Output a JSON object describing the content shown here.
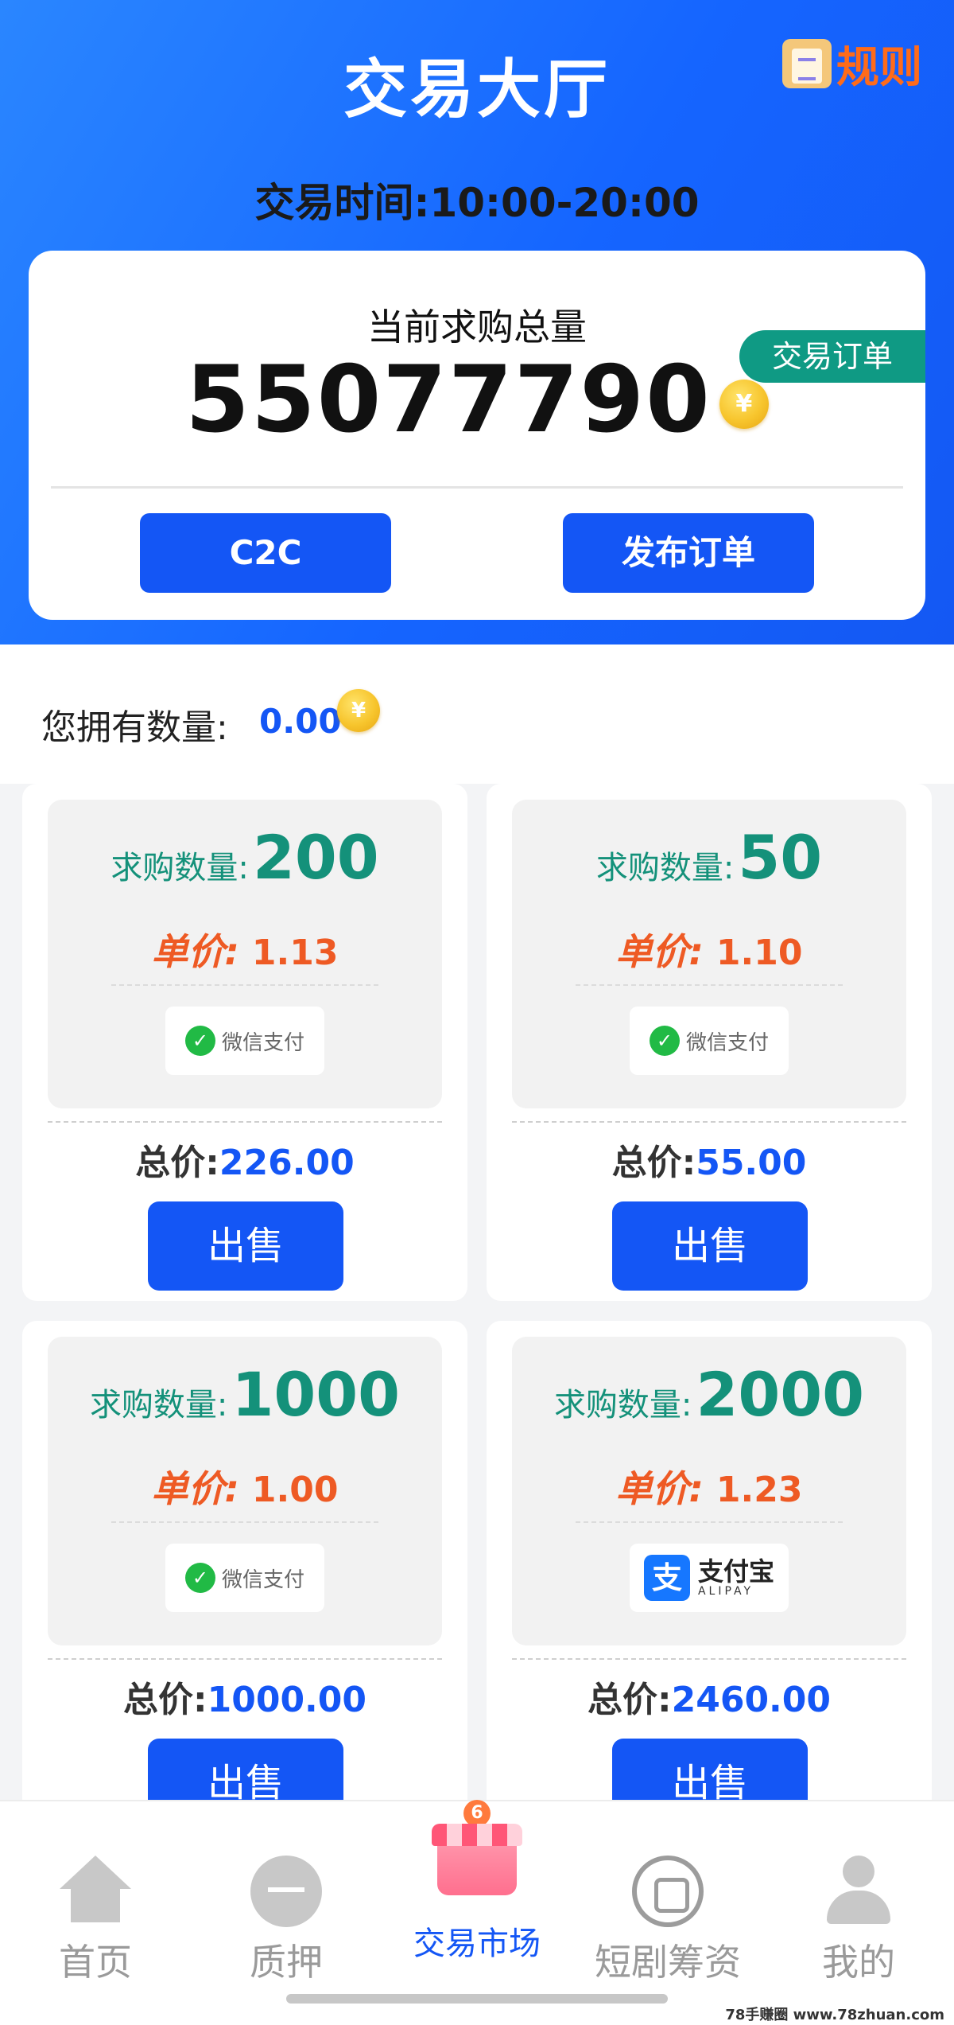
{
  "header": {
    "title": "交易大厅",
    "rules_label": "规则",
    "trade_time": "交易时间:10:00-20:00"
  },
  "summary": {
    "label": "当前求购总量",
    "value": "55077790",
    "coin_symbol": "¥",
    "order_tab": "交易订单",
    "c2c_button": "C2C",
    "publish_button": "发布订单"
  },
  "owned": {
    "label": "您拥有数量:",
    "value": "0.00",
    "coin_symbol": "¥"
  },
  "orders": [
    {
      "qty_label": "求购数量:",
      "qty": "200",
      "price_label": "单价:",
      "price": "1.13",
      "payment": "微信支付",
      "total_label": "总价:",
      "total": "226.00",
      "sell": "出售"
    },
    {
      "qty_label": "求购数量:",
      "qty": "50",
      "price_label": "单价:",
      "price": "1.10",
      "payment": "微信支付",
      "total_label": "总价:",
      "total": "55.00",
      "sell": "出售"
    },
    {
      "qty_label": "求购数量:",
      "qty": "1000",
      "price_label": "单价:",
      "price": "1.00",
      "payment": "微信支付",
      "total_label": "总价:",
      "total": "1000.00",
      "sell": "出售"
    },
    {
      "qty_label": "求购数量:",
      "qty": "2000",
      "price_label": "单价:",
      "price": "1.23",
      "payment": "支付宝",
      "payment_sub": "ALIPAY",
      "total_label": "总价:",
      "total": "2460.00",
      "sell": "出售"
    }
  ],
  "tabbar": {
    "items": [
      {
        "label": "首页",
        "icon": "home-icon"
      },
      {
        "label": "质押",
        "icon": "pledge-icon"
      },
      {
        "label": "交易市场",
        "icon": "market-icon",
        "badge": "6",
        "active": true
      },
      {
        "label": "短剧筹资",
        "icon": "drama-icon"
      },
      {
        "label": "我的",
        "icon": "user-icon"
      }
    ]
  },
  "watermark": "78手赚圈 www.78zhuan.com",
  "colors": {
    "primary": "#1456f5",
    "teal": "#14917a",
    "orange": "#ee5a24"
  }
}
